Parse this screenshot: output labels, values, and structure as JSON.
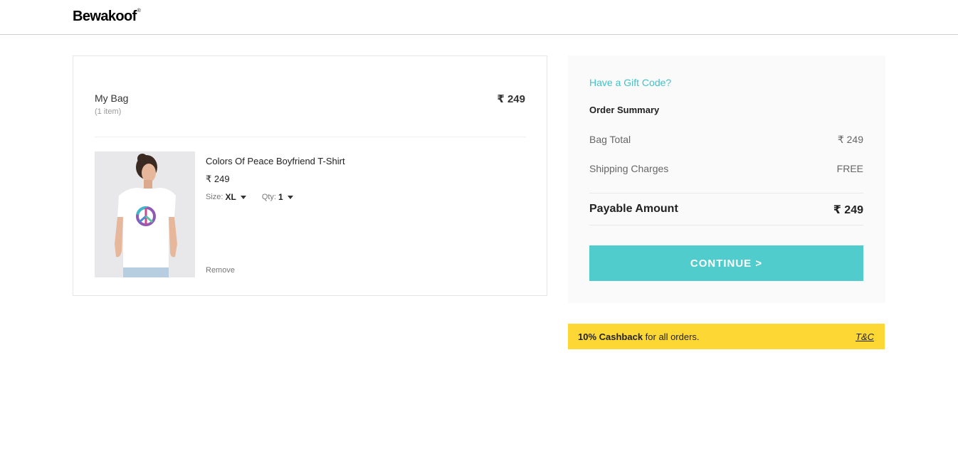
{
  "header": {
    "logo": "Bewakoof",
    "logo_mark": "®"
  },
  "bag": {
    "title": "My Bag",
    "count": "(1 item)",
    "total": "₹ 249",
    "items": [
      {
        "name": "Colors Of Peace Boyfriend T-Shirt",
        "price": "₹ 249",
        "size_label": "Size:",
        "size_value": "XL",
        "qty_label": "Qty:",
        "qty_value": "1",
        "remove_label": "Remove"
      }
    ]
  },
  "summary": {
    "gift_code": "Have a Gift Code?",
    "title": "Order Summary",
    "bag_total_label": "Bag Total",
    "bag_total_value": "₹ 249",
    "shipping_label": "Shipping Charges",
    "shipping_value": "FREE",
    "payable_label": "Payable Amount",
    "payable_value": "₹ 249",
    "continue_label": "CONTINUE >"
  },
  "cashback": {
    "bold": "10% Cashback",
    "rest": " for all orders.",
    "tc": "T&C"
  },
  "colors": {
    "accent": "#51cccc",
    "gift_link": "#42c2c6",
    "cashback_bg": "#fdd835"
  }
}
